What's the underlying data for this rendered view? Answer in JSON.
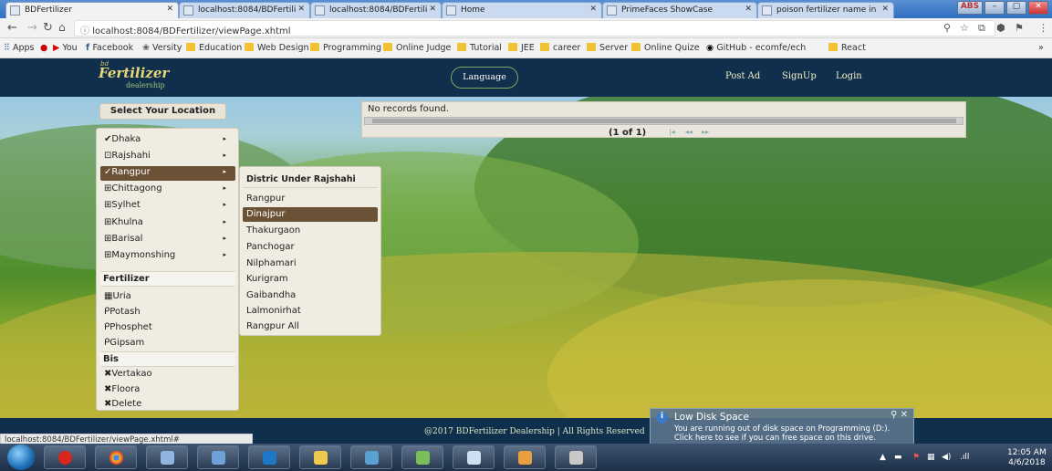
{
  "browser": {
    "tabs": [
      {
        "label": "BDFertilizer",
        "active": true
      },
      {
        "label": "localhost:8084/BDFertili"
      },
      {
        "label": "localhost:8084/BDFertili"
      },
      {
        "label": "Home"
      },
      {
        "label": "PrimeFaces ShowCase"
      },
      {
        "label": "poison fertilizer name in"
      }
    ],
    "window_user": "ABS",
    "url": "localhost:8084/BDFertilizer/viewPage.xhtml",
    "bookmarks": [
      "Apps",
      "You",
      "Facebook",
      "Versity",
      "Education",
      "Web Design",
      "Programming",
      "Online Judge",
      "Tutorial",
      "JEE",
      "career",
      "Server",
      "Online Quize",
      "GitHub - ecomfe/ech",
      "React"
    ]
  },
  "site": {
    "logo_top": "bd",
    "logo_main": "Fertilizer",
    "logo_sub": "dealership",
    "language_button": "Language",
    "nav": [
      "Post Ad",
      "SignUp",
      "Login"
    ]
  },
  "location": {
    "heading": "Select Your Location",
    "divisions": [
      {
        "label": "Dhaka",
        "icon": "✔"
      },
      {
        "label": "Rajshahi",
        "icon": "⊡"
      },
      {
        "label": "Rangpur",
        "icon": "✓",
        "selected": true
      },
      {
        "label": "Chittagong",
        "icon": "⊞"
      },
      {
        "label": "Sylhet",
        "icon": "⊞"
      },
      {
        "label": "Khulna",
        "icon": "⊞"
      },
      {
        "label": "Barisal",
        "icon": "⊞"
      },
      {
        "label": "Maymonshing",
        "icon": "⊞"
      }
    ],
    "fertilizer_heading": "Fertilizer",
    "fertilizers": [
      {
        "label": "Uria",
        "icon": "▦"
      },
      {
        "label": "Potash",
        "icon": "ᑭ"
      },
      {
        "label": "Phosphet",
        "icon": "ᑭ"
      },
      {
        "label": "Gipsam",
        "icon": "ᑭ"
      }
    ],
    "bis_heading": "Bis",
    "bis": [
      {
        "label": "Vertakao",
        "icon": "✖"
      },
      {
        "label": "Floora",
        "icon": "✖"
      },
      {
        "label": "Delete",
        "icon": "✖"
      }
    ]
  },
  "submenu": {
    "heading": "Distric Under Rajshahi",
    "items": [
      {
        "label": "Rangpur"
      },
      {
        "label": "Dinajpur",
        "selected": true
      },
      {
        "label": "Thakurgaon"
      },
      {
        "label": "Panchogar"
      },
      {
        "label": "Nilphamari"
      },
      {
        "label": "Kurigram"
      },
      {
        "label": "Gaibandha"
      },
      {
        "label": "Lalmonirhat"
      },
      {
        "label": "Rangpur All"
      }
    ]
  },
  "records": {
    "message": "No records found.",
    "pager": "(1 of 1)"
  },
  "footer": {
    "copyright": "@2017 BDFertilizer Dealership | All Rights Reserved",
    "status_url": "localhost:8084/BDFertilizer/viewPage.xhtml#"
  },
  "notification": {
    "title": "Low Disk Space",
    "line1": "You are running out of disk space on Programming (D:).",
    "line2": "Click here to see if you can free space on this drive."
  },
  "taskbar": {
    "time": "12:05 AM",
    "date": "4/6/2018"
  }
}
